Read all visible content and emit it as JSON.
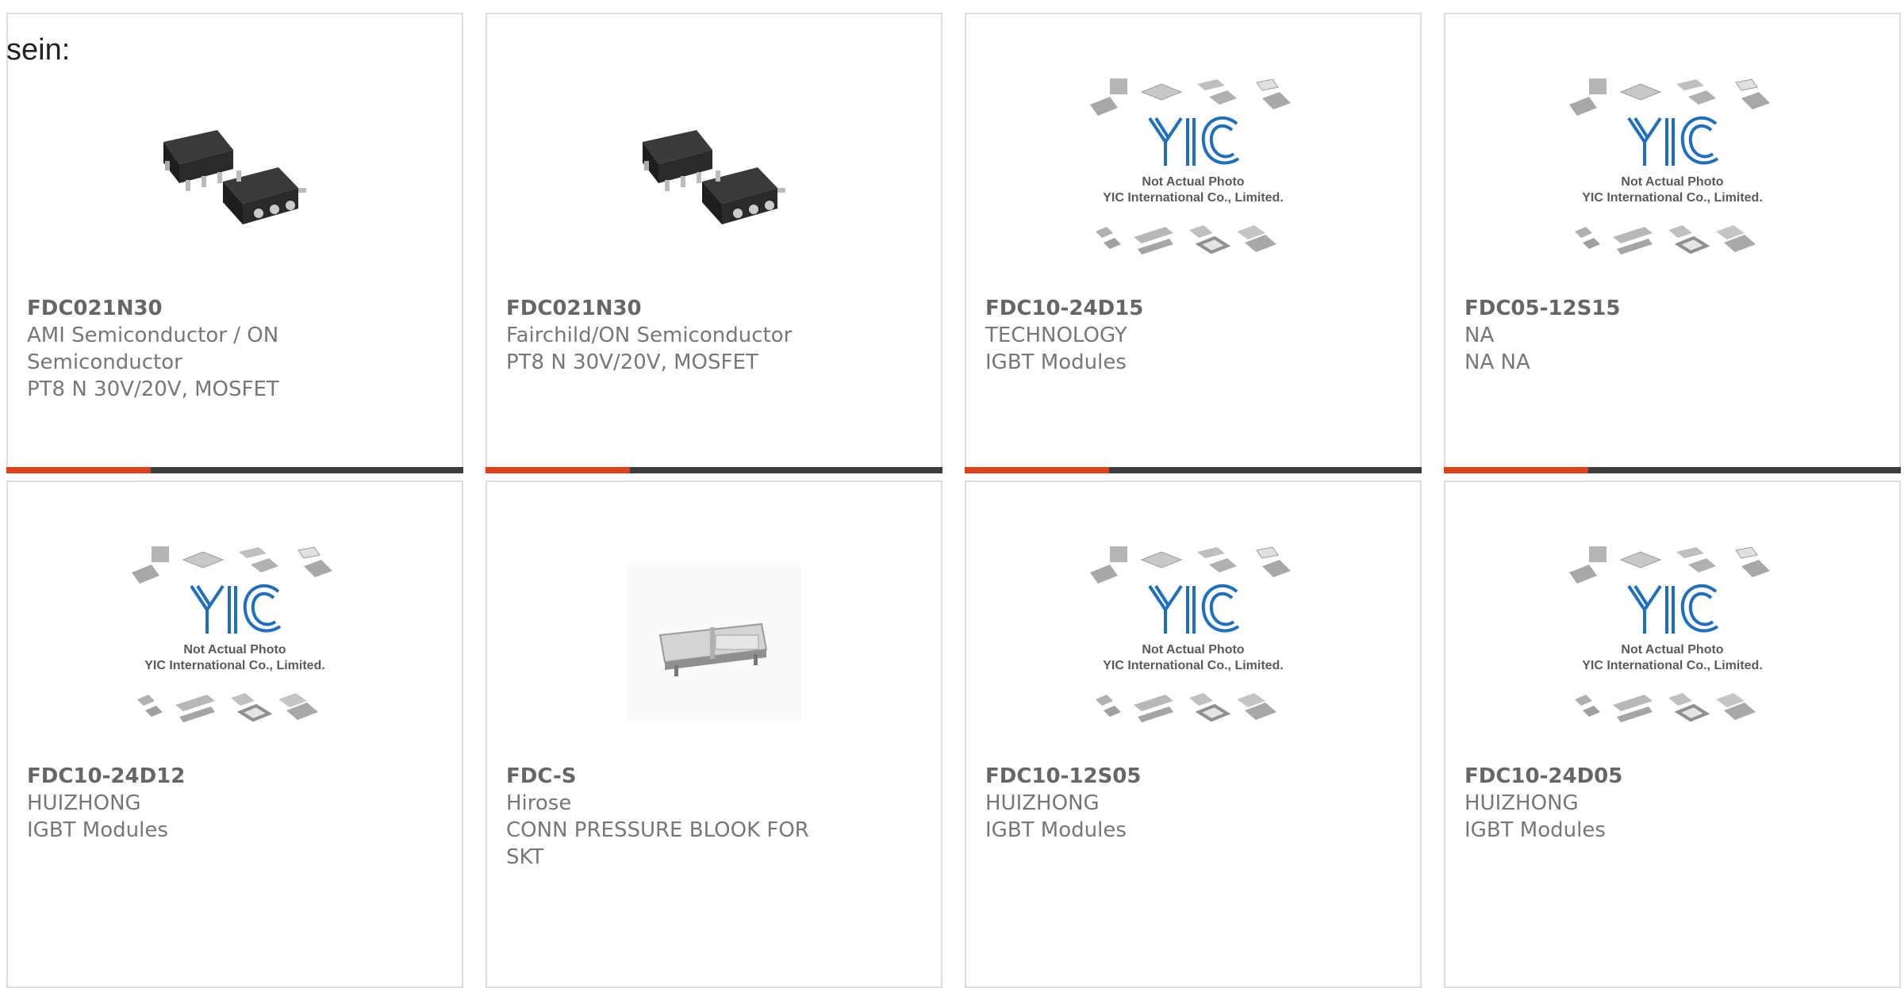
{
  "intro_text": "sein:",
  "colors": {
    "accent": "#e2401c",
    "bar": "#3d3d3d",
    "text": "#777777",
    "border": "#dcdcdc"
  },
  "products": [
    {
      "part": "FDC021N30",
      "lines": [
        "AMI Semiconductor / ON",
        "Semiconductor",
        "PT8 N 30V/20V, MOSFET"
      ],
      "image": "sot-chip-photo"
    },
    {
      "part": "FDC021N30",
      "lines": [
        "Fairchild/ON Semiconductor",
        "PT8 N 30V/20V, MOSFET"
      ],
      "image": "sot-chip-photo"
    },
    {
      "part": "FDC10-24D15",
      "lines": [
        "TECHNOLOGY",
        "IGBT Modules"
      ],
      "image": "yic-placeholder",
      "placeholder": {
        "logo": "YIC",
        "note": "Not Actual Photo",
        "company": "YIC International Co., Limited."
      }
    },
    {
      "part": "FDC05-12S15",
      "lines": [
        "NA",
        "NA NA"
      ],
      "image": "yic-placeholder",
      "placeholder": {
        "logo": "YIC",
        "note": "Not Actual Photo",
        "company": "YIC International Co., Limited."
      }
    },
    {
      "part": "FDC10-24D12",
      "lines": [
        "HUIZHONG",
        "IGBT Modules"
      ],
      "image": "yic-placeholder",
      "placeholder": {
        "logo": "YIC",
        "note": "Not Actual Photo",
        "company": "YIC International Co., Limited."
      }
    },
    {
      "part": "FDC-S",
      "lines": [
        "Hirose",
        "CONN PRESSURE BLOOK FOR",
        "SKT"
      ],
      "image": "connector-photo"
    },
    {
      "part": "FDC10-12S05",
      "lines": [
        "HUIZHONG",
        "IGBT Modules"
      ],
      "image": "yic-placeholder",
      "placeholder": {
        "logo": "YIC",
        "note": "Not Actual Photo",
        "company": "YIC International Co., Limited."
      }
    },
    {
      "part": "FDC10-24D05",
      "lines": [
        "HUIZHONG",
        "IGBT Modules"
      ],
      "image": "yic-placeholder",
      "placeholder": {
        "logo": "YIC",
        "note": "Not Actual Photo",
        "company": "YIC International Co., Limited."
      }
    }
  ]
}
